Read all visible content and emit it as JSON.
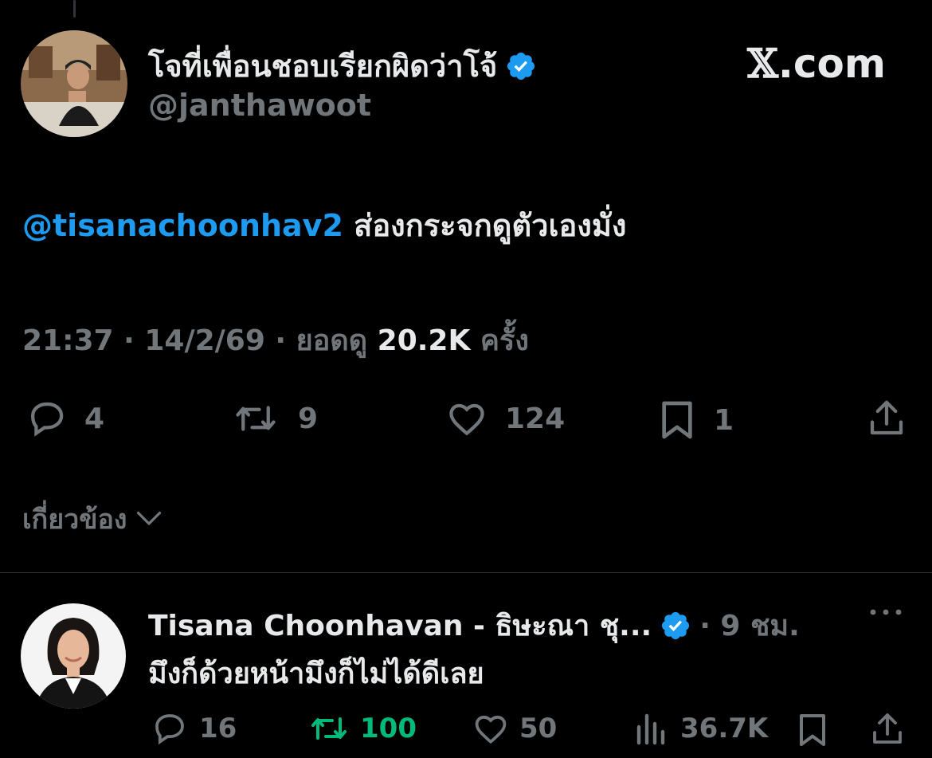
{
  "brand": {
    "x": "𝕏",
    "domain": ".com"
  },
  "tweet": {
    "display_name": "โจที่เพื่อนชอบเรียกผิดว่าโจ้",
    "handle": "@janthawoot",
    "mention": "@tisanachoonhav2",
    "text": " ส่องกระจกดูตัวเองมั่ง",
    "time": "21:37",
    "sep": " · ",
    "date": "14/2/69",
    "views_label": "ยอดดู ",
    "views": "20.2K",
    "views_suffix": " ครั้ง",
    "counts": {
      "replies": "4",
      "reposts": "9",
      "likes": "124",
      "bookmarks": "1"
    }
  },
  "related": {
    "label": "เกี่ยวข้อง"
  },
  "reply": {
    "display_name": "Tisana Choonhavan - ธิษะณา ชุ...",
    "time": "· 9 ชม.",
    "text": "มึงก็ด้วยหน้ามึงก็ไม่ได้ดีเลย",
    "counts": {
      "replies": "16",
      "reposts": "100",
      "likes": "50",
      "views": "36.7K"
    }
  },
  "colors": {
    "background": "#000000",
    "accent": "#1d9bf0",
    "muted": "#71767b",
    "repost_active": "#00ba7c",
    "text": "#e7e9ea"
  },
  "icons": [
    "reply-icon",
    "repost-icon",
    "like-icon",
    "bookmark-icon",
    "share-icon",
    "verified-icon",
    "chevron-down-icon",
    "more-icon",
    "views-icon"
  ]
}
